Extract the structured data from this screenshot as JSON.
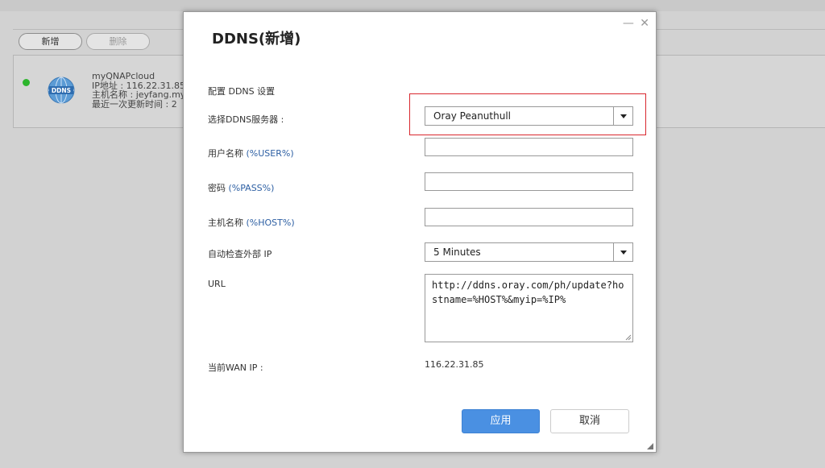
{
  "background": {
    "add_button": "新增",
    "delete_button": "删除",
    "entry": {
      "logo_text": "DDNS",
      "name": "myQNAPcloud",
      "ip_line": "IP地址 : 116.22.31.85",
      "host_line": "主机名称 : jeyfang.my",
      "updated_line": "最近一次更新时间 : 2"
    }
  },
  "modal": {
    "title": "DDNS(新增)",
    "section": "配置 DDNS 设置",
    "service_label": "选择DDNS服务器 :",
    "service_value": "Oray Peanuthull",
    "username_label": "用户名称",
    "username_hint": "(%USER%)",
    "username_value": "",
    "password_label": "密码",
    "password_hint": "(%PASS%)",
    "password_value": "",
    "hostname_label": "主机名称",
    "hostname_hint": "(%HOST%)",
    "hostname_value": "",
    "check_ip_label": "自动检查外部 IP",
    "check_ip_value": "5 Minutes",
    "url_label": "URL",
    "url_value": "http://ddns.oray.com/ph/update?hostname=%HOST%&myip=%IP%",
    "wan_label": "当前WAN IP :",
    "wan_value": "116.22.31.85",
    "apply_button": "应用",
    "cancel_button": "取消",
    "minimize_icon": "—",
    "close_icon": "✕"
  },
  "colors": {
    "accent": "#4a90e2",
    "highlight": "#d9272e",
    "status_online": "#2db52d",
    "hint_text": "#2d5fa3"
  }
}
